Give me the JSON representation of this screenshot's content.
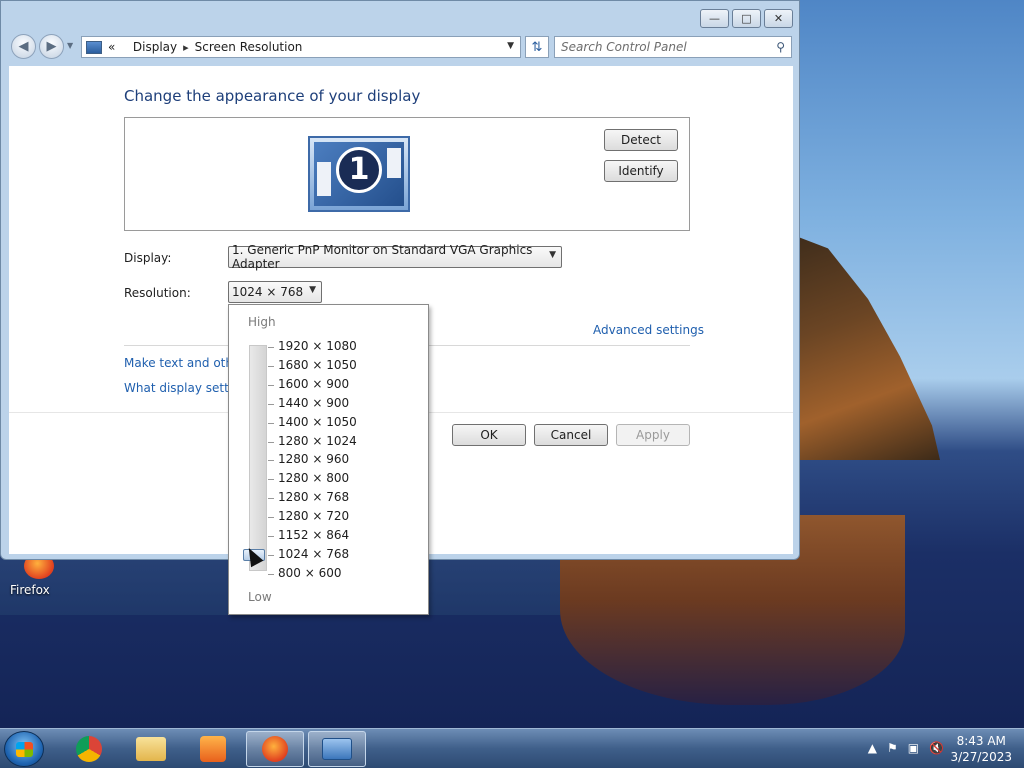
{
  "address": {
    "crumbs": [
      "Display",
      "Screen Resolution"
    ],
    "search_placeholder": "Search Control Panel"
  },
  "main": {
    "heading": "Change the appearance of your display",
    "detect_label": "Detect",
    "identify_label": "Identify",
    "monitor_number": "1",
    "display_label": "Display:",
    "display_value": "1. Generic PnP Monitor on Standard VGA Graphics Adapter",
    "resolution_label": "Resolution:",
    "resolution_value": "1024 × 768",
    "advanced_link": "Advanced settings",
    "link_text_size": "Make text and other",
    "link_display_settings": "What display setting",
    "ok_label": "OK",
    "cancel_label": "Cancel",
    "apply_label": "Apply"
  },
  "resolution_menu": {
    "high_label": "High",
    "low_label": "Low",
    "options": [
      "1920 × 1080",
      "1680 × 1050",
      "1600 × 900",
      "1440 × 900",
      "1400 × 1050",
      "1280 × 1024",
      "1280 × 960",
      "1280 × 800",
      "1280 × 768",
      "1280 × 720",
      "1152 × 864",
      "1024 × 768",
      "800 × 600"
    ],
    "selected": "1024 × 768"
  },
  "desktop": {
    "icons": [
      {
        "label": "Firefox",
        "icon": "firefox-icon"
      }
    ]
  },
  "taskbar": {
    "apps": [
      {
        "name": "chrome",
        "icon": "chrome-icon",
        "active": false
      },
      {
        "name": "file-explorer",
        "icon": "folder-icon",
        "active": false
      },
      {
        "name": "media-player",
        "icon": "media-player-icon",
        "active": false
      },
      {
        "name": "firefox",
        "icon": "firefox-icon",
        "active": true
      },
      {
        "name": "control-panel",
        "icon": "control-panel-icon",
        "active": true
      }
    ],
    "time": "8:43 AM",
    "date": "3/27/2023"
  }
}
